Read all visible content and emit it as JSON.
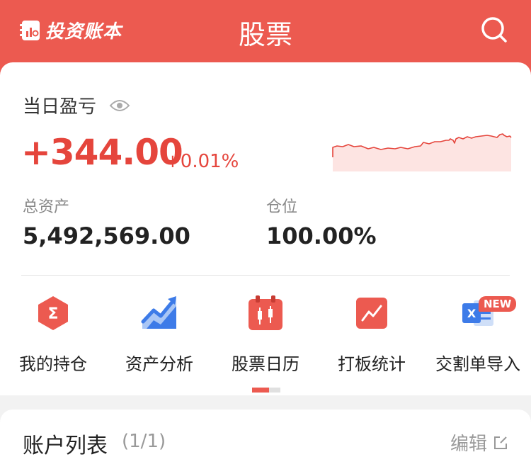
{
  "header": {
    "logo_text": "投资账本",
    "title": "股票"
  },
  "summary": {
    "pnl_label": "当日盈亏",
    "pnl_value": "+344.00",
    "pnl_pct": "+0.01%",
    "total_assets_label": "总资产",
    "total_assets_value": "5,492,569.00",
    "position_label": "仓位",
    "position_value": "100.00%"
  },
  "shortcuts": [
    {
      "label": "我的持仓",
      "icon": "holdings-icon"
    },
    {
      "label": "资产分析",
      "icon": "asset-analysis-icon"
    },
    {
      "label": "股票日历",
      "icon": "calendar-icon"
    },
    {
      "label": "打板统计",
      "icon": "board-stats-icon"
    },
    {
      "label": "交割单导入",
      "icon": "excel-import-icon",
      "badge": "NEW"
    }
  ],
  "account_list": {
    "title": "账户列表",
    "count": "(1/1)",
    "edit_label": "编辑"
  },
  "colors": {
    "brand": "#ec5a50",
    "up": "#e5453c"
  }
}
